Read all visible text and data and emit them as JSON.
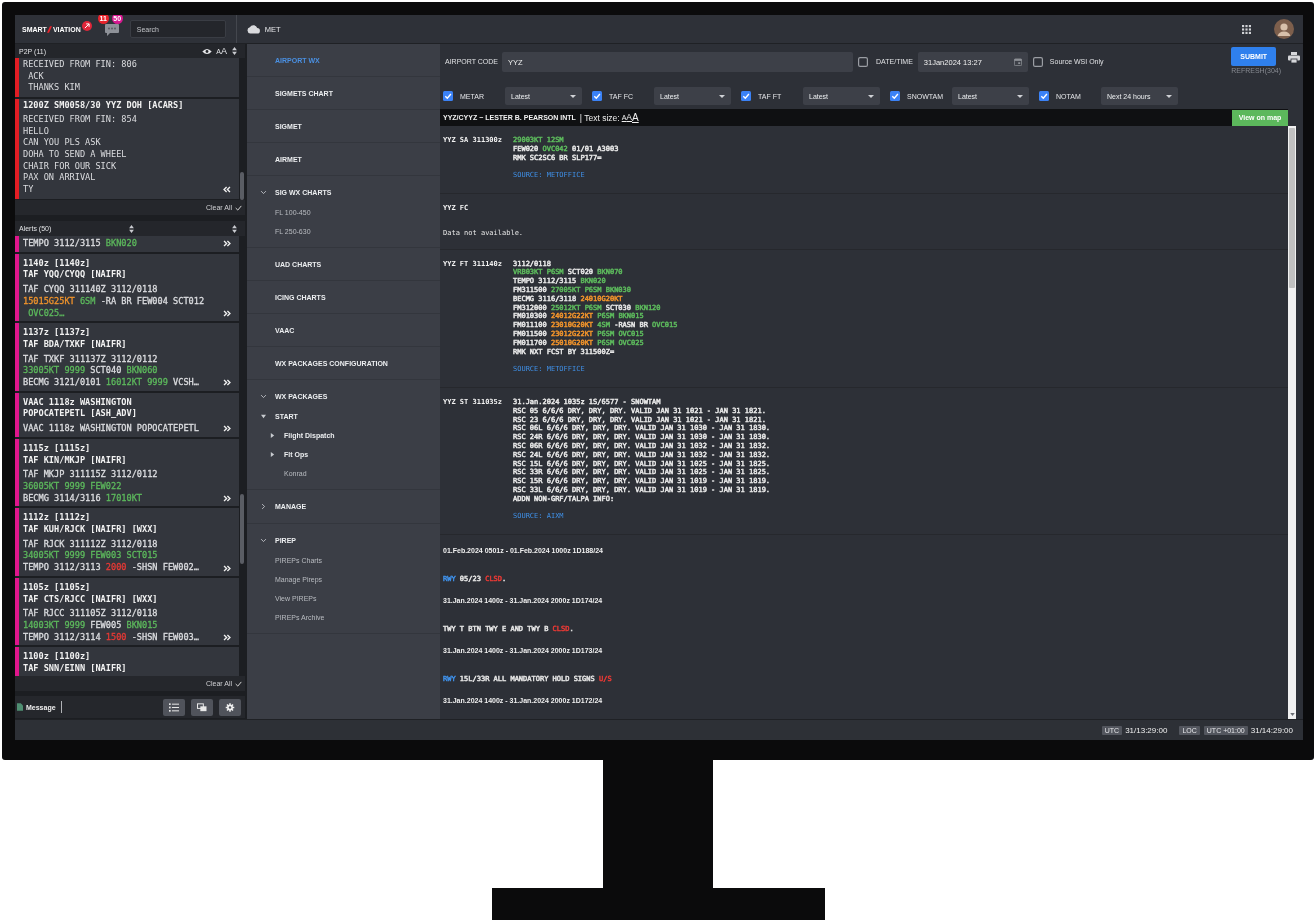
{
  "top_bar": {
    "logo": {
      "left": "SMART",
      "right": "VIATION"
    },
    "chat_badges": [
      {
        "count": "11",
        "color": "#e8222b"
      },
      {
        "count": "50",
        "color": "#d6178f"
      }
    ],
    "search": {
      "placeholder": "Search"
    },
    "module": "MET"
  },
  "p2p": {
    "title": "P2P (11)",
    "text_size_label": "AA",
    "messages": [
      {
        "collapsible": false,
        "lines": [
          "RECEIVED FROM FIN: 806",
          " ACK",
          " THANKS KIM"
        ]
      },
      {
        "collapsible": true,
        "heading": "1200Z SM0058/30 YYZ DOH [ACARS]",
        "lines": [
          "RECEIVED FROM FIN: 854",
          "HELLO",
          "CAN YOU PLS ASK",
          "DOHA TO SEND A WHEEL",
          "CHAIR FOR OUR SICK",
          "PAX ON ARRIVAL",
          "TY"
        ]
      }
    ],
    "clear_all": "Clear All"
  },
  "alerts": {
    "title": "Alerts (50)",
    "items": [
      {
        "body": [
          [
            {
              "text": "TEMPO 3112/3115 "
            },
            {
              "text": "BKN020",
              "color": "#5cb85c"
            }
          ]
        ]
      },
      {
        "title_lines": [
          "1140z [1140z]",
          "TAF YQQ/CYQQ [NAIFR]"
        ],
        "body": [
          [
            {
              "text": "TAF CYQQ 311140Z 3112/0118"
            }
          ],
          [
            {
              "text": "15015G25KT",
              "color": "#f0932b"
            },
            {
              "text": " 6SM",
              "color": "#5cb85c"
            },
            {
              "text": " -RA BR FEW004 SCT012"
            }
          ],
          [
            {
              "text": " OVC025…",
              "color": "#5cb85c"
            }
          ]
        ]
      },
      {
        "title_lines": [
          "1137z [1137z]",
          "TAF BDA/TXKF [NAIFR]"
        ],
        "body": [
          [
            {
              "text": "TAF TXKF 311137Z 3112/0112"
            }
          ],
          [
            {
              "text": "33005KT 9999",
              "color": "#5cb85c"
            },
            {
              "text": " SCT040 "
            },
            {
              "text": "BKN060",
              "color": "#5cb85c"
            }
          ],
          [
            {
              "text": "BECMG 3121/0101 "
            },
            {
              "text": "16012KT 9999",
              "color": "#5cb85c"
            },
            {
              "text": " VCSH…"
            }
          ]
        ]
      },
      {
        "title_lines": [
          "VAAC 1118z WASHINGTON",
          "POPOCATEPETL [ASH_ADV]"
        ],
        "body": [
          [
            {
              "text": "VAAC 1118z WASHINGTON POPOCATEPETL"
            }
          ]
        ]
      },
      {
        "title_lines": [
          "1115z [1115z]",
          "TAF KIN/MKJP [NAIFR]"
        ],
        "body": [
          [
            {
              "text": "TAF MKJP 311115Z 3112/0112"
            }
          ],
          [
            {
              "text": "36005KT 9999 FEW022",
              "color": "#5cb85c"
            }
          ],
          [
            {
              "text": "BECMG 3114/3116 "
            },
            {
              "text": "17010KT",
              "color": "#5cb85c"
            }
          ]
        ]
      },
      {
        "title_lines": [
          "1112z [1112z]",
          "TAF KUH/RJCK [NAIFR] [WXX]"
        ],
        "body": [
          [
            {
              "text": "TAF RJCK 311112Z 3112/0118"
            }
          ],
          [
            {
              "text": "34005KT 9999 FEW003 SCT015",
              "color": "#5cb85c"
            }
          ],
          [
            {
              "text": "TEMPO 3112/3113 "
            },
            {
              "text": "2000",
              "color": "#e53935"
            },
            {
              "text": " -SHSN FEW002…"
            }
          ]
        ]
      },
      {
        "title_lines": [
          "1105z [1105z]",
          "TAF CTS/RJCC [NAIFR] [WXX]"
        ],
        "body": [
          [
            {
              "text": "TAF RJCC 311105Z 3112/0118"
            }
          ],
          [
            {
              "text": "14003KT 9999",
              "color": "#5cb85c"
            },
            {
              "text": " FEW005 "
            },
            {
              "text": "BKN015",
              "color": "#5cb85c"
            }
          ],
          [
            {
              "text": "TEMPO 3112/3114 "
            },
            {
              "text": "1500",
              "color": "#e53935"
            },
            {
              "text": " -SHSN FEW003…"
            }
          ]
        ]
      },
      {
        "title_lines": [
          "1100z [1100z]",
          "TAF SNN/EINN [NAIFR]"
        ]
      }
    ],
    "clear_all": "Clear All"
  },
  "message_tab": "Message",
  "nav": {
    "items": [
      {
        "label": "AIRPORT WX",
        "kind": "page",
        "selected": true
      },
      {
        "label": "SIGMETS CHART",
        "kind": "page",
        "selected": false
      },
      {
        "label": "SIGMET",
        "kind": "page",
        "selected": false
      },
      {
        "label": "AIRMET",
        "kind": "page",
        "selected": false
      },
      {
        "label": "SIG WX CHARTS",
        "kind": "section",
        "selected": false,
        "expanded": true,
        "children": [
          {
            "label": "FL 100-450",
            "kind": "link",
            "selected": false
          },
          {
            "label": "FL 250-630",
            "kind": "link",
            "selected": false
          }
        ]
      },
      {
        "label": "UAD CHARTS",
        "kind": "page",
        "selected": false
      },
      {
        "label": "ICING CHARTS",
        "kind": "page",
        "selected": false
      },
      {
        "label": "VAAC",
        "kind": "page",
        "selected": false
      },
      {
        "label": "WX PACKAGES CONFIGURATION",
        "kind": "page",
        "selected": false
      },
      {
        "label": "WX PACKAGES",
        "kind": "section",
        "selected": false,
        "expanded": true,
        "children": [
          {
            "label": "START",
            "kind": "folder",
            "selected": false,
            "expanded": true,
            "children": [
              {
                "label": "Flight Dispatch",
                "kind": "folder",
                "selected": false,
                "expanded": false
              },
              {
                "label": "Flt Ops",
                "kind": "folder",
                "selected": false,
                "expanded": false
              },
              {
                "label": "Konrad",
                "kind": "link",
                "selected": false
              }
            ]
          }
        ]
      },
      {
        "label": "MANAGE",
        "kind": "section",
        "selected": false,
        "expanded": false
      },
      {
        "label": "PIREP",
        "kind": "section",
        "selected": false,
        "expanded": true,
        "children": [
          {
            "label": "PIREPs Charts",
            "kind": "link",
            "selected": false
          },
          {
            "label": "Manage Pireps",
            "kind": "link",
            "selected": false
          },
          {
            "label": "View PIREPs",
            "kind": "link",
            "selected": false
          },
          {
            "label": "PIREPs Archive",
            "kind": "link",
            "selected": false
          }
        ]
      }
    ]
  },
  "airport_wx": {
    "form": {
      "airport_code": {
        "label": "AIRPORT CODE",
        "value": "YYZ"
      },
      "date_time": {
        "checked": false,
        "label": "DATE/TIME",
        "value": "31Jan2024 13:27"
      },
      "source_wsi": {
        "checked": false,
        "label": "Source WSI Only"
      },
      "submit": "SUBMIT",
      "refresh": "REFRESH(304)"
    },
    "filters": [
      {
        "checked": true,
        "label": "METAR",
        "value": "Latest"
      },
      {
        "checked": true,
        "label": "TAF FC",
        "value": "Latest"
      },
      {
        "checked": true,
        "label": "TAF FT",
        "value": "Latest"
      },
      {
        "checked": true,
        "label": "SNOWTAM",
        "value": "Latest"
      },
      {
        "checked": true,
        "label": "NOTAM",
        "value": "Next 24 hours"
      }
    ],
    "station": {
      "title": "YYZ/CYYZ ~ LESTER B. PEARSON INTL",
      "text_size_label": "| Text size:",
      "text_sizes": [
        "A",
        "A",
        "A"
      ],
      "map_button": "View on map"
    },
    "reports": [
      {
        "kind": "report",
        "label": "YYZ SA 311300z",
        "lines": [
          [
            {
              "text": "29003KT 12SM",
              "color": "#5cb85c"
            }
          ],
          [
            {
              "text": "FEW020 "
            },
            {
              "text": "OVC042",
              "color": "#5cb85c"
            },
            {
              "text": " 01/01 A3003"
            }
          ],
          [
            {
              "text": "RMK SC2SC6 BR SLP177="
            }
          ]
        ],
        "source": "SOURCE: METOFFICE"
      },
      {
        "kind": "empty",
        "label": "YYZ FC",
        "message": "Data not available."
      },
      {
        "kind": "report",
        "label": "YYZ FT 311140z",
        "lines": [
          [
            {
              "text": "3112/0118"
            }
          ],
          [
            {
              "text": "VRB03KT P6SM",
              "color": "#5cb85c"
            },
            {
              "text": " SCT020 "
            },
            {
              "text": "BKN070",
              "color": "#5cb85c"
            }
          ],
          [
            {
              "text": "TEMPO 3112/3115 "
            },
            {
              "text": "BKN020",
              "color": "#5cb85c"
            }
          ],
          [
            {
              "text": "FM311500 "
            },
            {
              "text": "27005KT P6SM BKN030",
              "color": "#5cb85c"
            }
          ],
          [
            {
              "text": "BECMG 3116/3118 "
            },
            {
              "text": "24010G20KT",
              "color": "#f0932b"
            }
          ],
          [
            {
              "text": "FM312000 "
            },
            {
              "text": "25012KT P6SM",
              "color": "#5cb85c"
            },
            {
              "text": " SCT030 "
            },
            {
              "text": "BKN120",
              "color": "#5cb85c"
            }
          ],
          [
            {
              "text": "FM010300 "
            },
            {
              "text": "24012G22KT",
              "color": "#f0932b"
            },
            {
              "text": " P6SM BKN015",
              "color": "#5cb85c"
            }
          ],
          [
            {
              "text": "FM011100 "
            },
            {
              "text": "23010G20KT",
              "color": "#f0932b"
            },
            {
              "text": " 4SM",
              "color": "#5cb85c"
            },
            {
              "text": " -RASN BR "
            },
            {
              "text": "OVC015",
              "color": "#5cb85c"
            }
          ],
          [
            {
              "text": "FM011500 "
            },
            {
              "text": "23012G22KT",
              "color": "#f0932b"
            },
            {
              "text": " P6SM OVC015",
              "color": "#5cb85c"
            }
          ],
          [
            {
              "text": "FM011700 "
            },
            {
              "text": "25010G20KT",
              "color": "#f0932b"
            },
            {
              "text": " P6SM OVC025",
              "color": "#5cb85c"
            }
          ],
          [
            {
              "text": "RMK NXT FCST BY 311500Z="
            }
          ]
        ],
        "source": "SOURCE: METOFFICE"
      },
      {
        "kind": "report",
        "label": "YYZ ST 311035z",
        "lines": [
          [
            {
              "text": "31.Jan.2024 1035z 1S/6577 - SNOWTAM"
            }
          ],
          [
            {
              "text": "RSC 05 6/6/6 DRY, DRY, DRY. VALID JAN 31 1021 - JAN 31 1821."
            }
          ],
          [
            {
              "text": "RSC 23 6/6/6 DRY, DRY, DRY. VALID JAN 31 1021 - JAN 31 1821."
            }
          ],
          [
            {
              "text": "RSC 06L 6/6/6 DRY, DRY, DRY. VALID JAN 31 1030 - JAN 31 1830."
            }
          ],
          [
            {
              "text": "RSC 24R 6/6/6 DRY, DRY, DRY. VALID JAN 31 1030 - JAN 31 1830."
            }
          ],
          [
            {
              "text": "RSC 06R 6/6/6 DRY, DRY, DRY. VALID JAN 31 1032 - JAN 31 1832."
            }
          ],
          [
            {
              "text": "RSC 24L 6/6/6 DRY, DRY, DRY. VALID JAN 31 1032 - JAN 31 1832."
            }
          ],
          [
            {
              "text": "RSC 15L 6/6/6 DRY, DRY, DRY. VALID JAN 31 1025 - JAN 31 1825."
            }
          ],
          [
            {
              "text": "RSC 33R 6/6/6 DRY, DRY, DRY. VALID JAN 31 1025 - JAN 31 1825."
            }
          ],
          [
            {
              "text": "RSC 15R 6/6/6 DRY, DRY, DRY. VALID JAN 31 1019 - JAN 31 1819."
            }
          ],
          [
            {
              "text": "RSC 33L 6/6/6 DRY, DRY, DRY. VALID JAN 31 1019 - JAN 31 1819."
            }
          ],
          [
            {
              "text": "ADDN NON-GRF/TALPA INFO:"
            }
          ]
        ],
        "source": "SOURCE: AIXM"
      }
    ],
    "notams": [
      {
        "period": "01.Feb.2024 0501z - 01.Feb.2024 1000z 1D188/24",
        "text": [
          {
            "text": "RWY",
            "color": "#3f8fe6"
          },
          {
            "text": " 05/23 "
          },
          {
            "text": "CLSD",
            "color": "#e53935"
          },
          {
            "text": "."
          }
        ]
      },
      {
        "period": "31.Jan.2024 1400z - 31.Jan.2024 2000z 1D174/24",
        "text": [
          {
            "text": "TWY T BTN TWY E AND TWY B "
          },
          {
            "text": "CLSD",
            "color": "#e53935"
          },
          {
            "text": "."
          }
        ]
      },
      {
        "period": "31.Jan.2024 1400z - 31.Jan.2024 2000z 1D173/24",
        "text": [
          {
            "text": "RWY",
            "color": "#3f8fe6"
          },
          {
            "text": " 15L/33R ALL MANDATORY HOLD SIGNS "
          },
          {
            "text": "U/S",
            "color": "#e53935"
          }
        ]
      },
      {
        "period": "31.Jan.2024 1400z - 31.Jan.2024 2000z 1D172/24"
      }
    ]
  },
  "status_bar": {
    "utc_tag": "UTC",
    "utc_time": "31/13:29:00",
    "loc_tag": "LOC",
    "offset_tag": "UTC +01:00",
    "local_time": "31/14:29:00"
  }
}
